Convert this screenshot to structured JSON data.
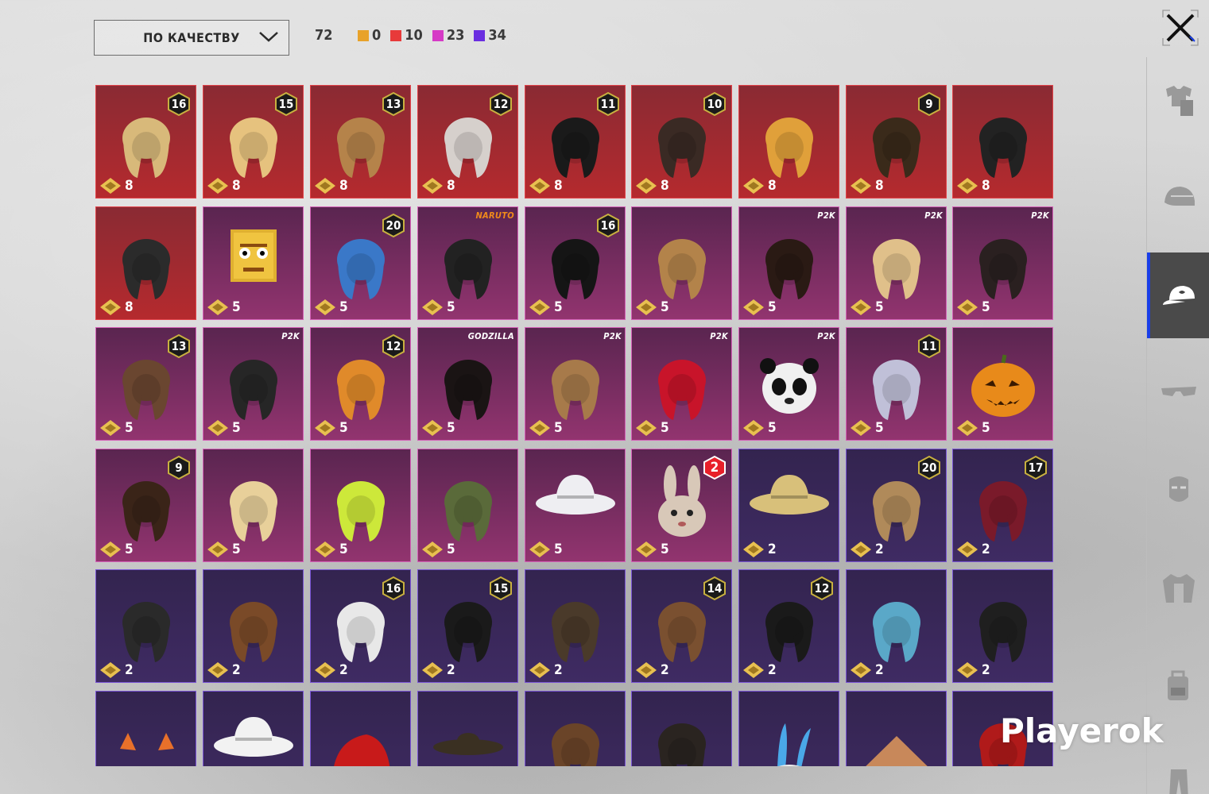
{
  "toolbar": {
    "sort_label": "ПО КАЧЕСТВУ",
    "total": "72",
    "legend": [
      {
        "color": "#e8a22a",
        "count": "0"
      },
      {
        "color": "#e83a3a",
        "count": "10"
      },
      {
        "color": "#d63ac6",
        "count": "23"
      },
      {
        "color": "#6a2ee0",
        "count": "34"
      }
    ]
  },
  "sidebar": {
    "items": [
      {
        "icon": "outfit-icon"
      },
      {
        "icon": "helmet-icon"
      },
      {
        "icon": "cap-icon",
        "active": true
      },
      {
        "icon": "glasses-icon"
      },
      {
        "icon": "mask-icon"
      },
      {
        "icon": "jacket-icon"
      },
      {
        "icon": "backpack-icon"
      },
      {
        "icon": "pants-icon"
      }
    ]
  },
  "watermark": "Playerok",
  "items": [
    {
      "rarity": "red",
      "level": "16",
      "price": "8",
      "art": "cat-cap-hair"
    },
    {
      "rarity": "red",
      "level": "15",
      "price": "8",
      "art": "maid-blonde"
    },
    {
      "rarity": "red",
      "level": "13",
      "price": "8",
      "art": "boater-hat"
    },
    {
      "rarity": "red",
      "level": "12",
      "price": "8",
      "art": "silver-hair"
    },
    {
      "rarity": "red",
      "level": "11",
      "price": "8",
      "art": "black-short-hair"
    },
    {
      "rarity": "red",
      "level": "10",
      "price": "8",
      "art": "dark-long-hair"
    },
    {
      "rarity": "red",
      "level": "",
      "price": "8",
      "art": "skull-mask-hair"
    },
    {
      "rarity": "red",
      "level": "9",
      "price": "8",
      "art": "green-zombie"
    },
    {
      "rarity": "red",
      "level": "",
      "price": "8",
      "art": "cyber-helmet"
    },
    {
      "rarity": "red",
      "level": "",
      "price": "8",
      "art": "tricorn-hat"
    },
    {
      "rarity": "pink",
      "level": "",
      "price": "5",
      "art": "block-head"
    },
    {
      "rarity": "pink",
      "level": "20",
      "price": "5",
      "art": "blue-creature-hat"
    },
    {
      "rarity": "pink",
      "level": "",
      "price": "5",
      "art": "headband",
      "brand": "NARUTO"
    },
    {
      "rarity": "pink",
      "level": "16",
      "price": "5",
      "art": "headphones-black-hair"
    },
    {
      "rarity": "pink",
      "level": "",
      "price": "5",
      "art": "antler-buns"
    },
    {
      "rarity": "pink",
      "level": "",
      "price": "5",
      "art": "dark-ponytail",
      "brand": "P2K"
    },
    {
      "rarity": "pink",
      "level": "",
      "price": "5",
      "art": "blonde-skull-clip",
      "brand": "P2K"
    },
    {
      "rarity": "pink",
      "level": "",
      "price": "5",
      "art": "bob-ribbons",
      "brand": "P2K"
    },
    {
      "rarity": "pink",
      "level": "13",
      "price": "5",
      "art": "goggles-hair"
    },
    {
      "rarity": "pink",
      "level": "",
      "price": "5",
      "art": "cap-visor",
      "brand": "P2K"
    },
    {
      "rarity": "pink",
      "level": "12",
      "price": "5",
      "art": "orange-pigtails"
    },
    {
      "rarity": "pink",
      "level": "",
      "price": "5",
      "art": "fur-hat",
      "brand": "GODZILLA"
    },
    {
      "rarity": "pink",
      "level": "",
      "price": "5",
      "art": "llama-mask",
      "brand": "P2K"
    },
    {
      "rarity": "pink",
      "level": "",
      "price": "5",
      "art": "red-hair",
      "brand": "P2K"
    },
    {
      "rarity": "pink",
      "level": "",
      "price": "5",
      "art": "panda-head",
      "brand": "P2K"
    },
    {
      "rarity": "pink",
      "level": "11",
      "price": "5",
      "art": "floral-silver"
    },
    {
      "rarity": "pink",
      "level": "",
      "price": "5",
      "art": "pumpkin"
    },
    {
      "rarity": "pink",
      "level": "9",
      "price": "5",
      "art": "long-brown"
    },
    {
      "rarity": "pink",
      "level": "",
      "price": "5",
      "art": "aviator-curls"
    },
    {
      "rarity": "pink",
      "level": "",
      "price": "5",
      "art": "neon-bucket"
    },
    {
      "rarity": "pink",
      "level": "",
      "price": "5",
      "art": "army-helmet"
    },
    {
      "rarity": "pink",
      "level": "",
      "price": "5",
      "art": "white-hat"
    },
    {
      "rarity": "pink",
      "level": "2",
      "price": "5",
      "art": "bunny-head",
      "redbadge": true
    },
    {
      "rarity": "purple",
      "level": "",
      "price": "2",
      "art": "cowboy-hat"
    },
    {
      "rarity": "purple",
      "level": "20",
      "price": "2",
      "art": "headband-bob"
    },
    {
      "rarity": "purple",
      "level": "17",
      "price": "2",
      "art": "crown-red"
    },
    {
      "rarity": "purple",
      "level": "",
      "price": "2",
      "art": "aviator-masks"
    },
    {
      "rarity": "purple",
      "level": "",
      "price": "2",
      "art": "long-brown-flower"
    },
    {
      "rarity": "purple",
      "level": "16",
      "price": "2",
      "art": "newspaper-cap"
    },
    {
      "rarity": "purple",
      "level": "15",
      "price": "2",
      "art": "beanie-pumpkin"
    },
    {
      "rarity": "purple",
      "level": "",
      "price": "2",
      "art": "visor-hair"
    },
    {
      "rarity": "purple",
      "level": "14",
      "price": "2",
      "art": "cat-cap-brown"
    },
    {
      "rarity": "purple",
      "level": "12",
      "price": "2",
      "art": "bunny-helmet"
    },
    {
      "rarity": "purple",
      "level": "",
      "price": "2",
      "art": "colorful-cap"
    },
    {
      "rarity": "purple",
      "level": "",
      "price": "2",
      "art": "black-beret"
    },
    {
      "rarity": "purple",
      "level": "",
      "price": "",
      "art": "cat-ears"
    },
    {
      "rarity": "purple",
      "level": "",
      "price": "",
      "art": "sun-hat"
    },
    {
      "rarity": "purple",
      "level": "",
      "price": "",
      "art": "red-mohawk"
    },
    {
      "rarity": "purple",
      "level": "",
      "price": "",
      "art": "sombrero"
    },
    {
      "rarity": "purple",
      "level": "",
      "price": "",
      "art": "braid"
    },
    {
      "rarity": "purple",
      "level": "",
      "price": "",
      "art": "dark-hair-band"
    },
    {
      "rarity": "purple",
      "level": "",
      "price": "",
      "art": "bunny-band"
    },
    {
      "rarity": "purple",
      "level": "",
      "price": "",
      "art": "conical-hat"
    },
    {
      "rarity": "purple",
      "level": "",
      "price": "",
      "art": "red-beret"
    }
  ]
}
